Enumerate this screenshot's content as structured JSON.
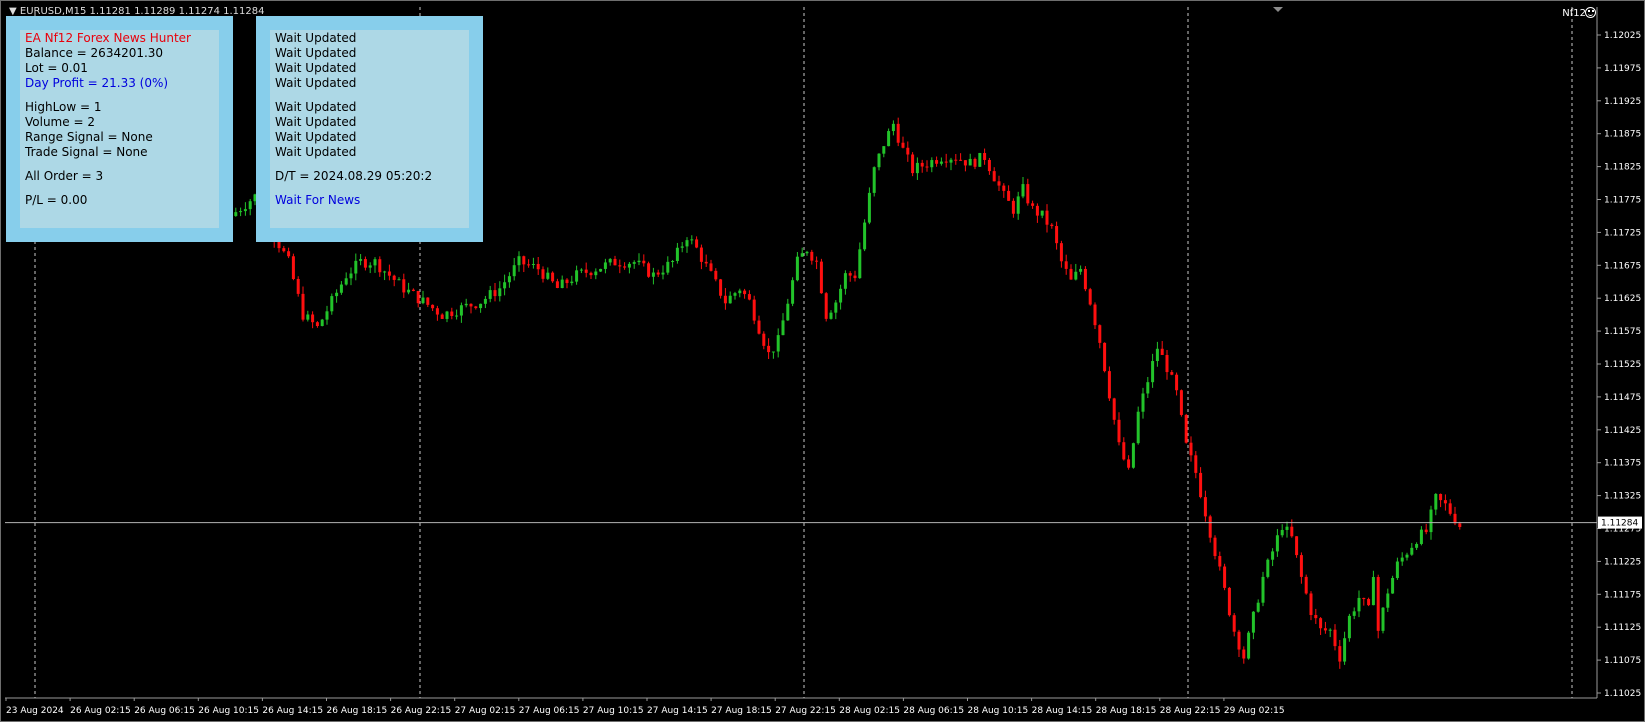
{
  "chart": {
    "symbol_line": "▼ EURUSD,M15  1.11281 1.11289 1.11274 1.11284",
    "ea_short_name": "Nf12",
    "current_price": "1.11284",
    "price_min": 1.1101,
    "price_max": 1.1205,
    "price_ticks": [
      "1.12025",
      "1.11975",
      "1.11925",
      "1.11875",
      "1.11825",
      "1.11775",
      "1.11725",
      "1.11675",
      "1.11625",
      "1.11575",
      "1.11525",
      "1.11475",
      "1.11425",
      "1.11375",
      "1.11325",
      "1.11275",
      "1.11225",
      "1.11175",
      "1.11125",
      "1.11075",
      "1.11025"
    ],
    "time_labels": [
      "23 Aug 2024",
      "26 Aug 02:15",
      "26 Aug 06:15",
      "26 Aug 10:15",
      "26 Aug 14:15",
      "26 Aug 18:15",
      "26 Aug 22:15",
      "27 Aug 02:15",
      "27 Aug 06:15",
      "27 Aug 10:15",
      "27 Aug 14:15",
      "27 Aug 18:15",
      "27 Aug 22:15",
      "28 Aug 02:15",
      "28 Aug 06:15",
      "28 Aug 10:15",
      "28 Aug 14:15",
      "28 Aug 18:15",
      "28 Aug 22:15",
      "29 Aug 02:15"
    ],
    "colors": {
      "bull": "#22c32a",
      "bear": "#ff0f0f",
      "grid": "#c8c8c8",
      "axis_text": "#ffffff",
      "background": "#000000"
    },
    "close_path": [
      [
        0,
        1.1175
      ],
      [
        5,
        1.1178
      ],
      [
        9,
        1.1172
      ],
      [
        12,
        1.1168
      ],
      [
        15,
        1.116
      ],
      [
        18,
        1.1158
      ],
      [
        21,
        1.1162
      ],
      [
        24,
        1.1166
      ],
      [
        27,
        1.1168
      ],
      [
        30,
        1.1168
      ],
      [
        33,
        1.1166
      ],
      [
        36,
        1.1164
      ],
      [
        40,
        1.1162
      ],
      [
        44,
        1.116
      ],
      [
        48,
        1.1161
      ],
      [
        52,
        1.1162
      ],
      [
        56,
        1.1164
      ],
      [
        60,
        1.1168
      ],
      [
        64,
        1.1167
      ],
      [
        68,
        1.1164
      ],
      [
        72,
        1.1166
      ],
      [
        76,
        1.1167
      ],
      [
        80,
        1.1168
      ],
      [
        84,
        1.1168
      ],
      [
        88,
        1.1166
      ],
      [
        92,
        1.1168
      ],
      [
        95,
        1.1172
      ],
      [
        97,
        1.117
      ],
      [
        100,
        1.1166
      ],
      [
        103,
        1.1162
      ],
      [
        106,
        1.1164
      ],
      [
        108,
        1.1162
      ],
      [
        110,
        1.1158
      ],
      [
        112,
        1.1154
      ],
      [
        114,
        1.1156
      ],
      [
        116,
        1.1162
      ],
      [
        118,
        1.1168
      ],
      [
        120,
        1.117
      ],
      [
        122,
        1.1168
      ],
      [
        124,
        1.116
      ],
      [
        126,
        1.1162
      ],
      [
        128,
        1.1166
      ],
      [
        130,
        1.1166
      ],
      [
        132,
        1.1174
      ],
      [
        134,
        1.1182
      ],
      [
        136,
        1.1186
      ],
      [
        138,
        1.1189
      ],
      [
        140,
        1.1185
      ],
      [
        142,
        1.1182
      ],
      [
        145,
        1.1183
      ],
      [
        148,
        1.1184
      ],
      [
        151,
        1.1184
      ],
      [
        154,
        1.1183
      ],
      [
        157,
        1.1184
      ],
      [
        159,
        1.1181
      ],
      [
        161,
        1.1178
      ],
      [
        163,
        1.1176
      ],
      [
        165,
        1.1179
      ],
      [
        167,
        1.1176
      ],
      [
        169,
        1.1175
      ],
      [
        171,
        1.1173
      ],
      [
        173,
        1.1168
      ],
      [
        175,
        1.1165
      ],
      [
        177,
        1.1167
      ],
      [
        179,
        1.1162
      ],
      [
        181,
        1.1156
      ],
      [
        183,
        1.1148
      ],
      [
        185,
        1.114
      ],
      [
        187,
        1.1136
      ],
      [
        189,
        1.1145
      ],
      [
        191,
        1.115
      ],
      [
        193,
        1.1155
      ],
      [
        195,
        1.1152
      ],
      [
        197,
        1.1148
      ],
      [
        199,
        1.114
      ],
      [
        201,
        1.1136
      ],
      [
        203,
        1.113
      ],
      [
        205,
        1.1124
      ],
      [
        207,
        1.1118
      ],
      [
        209,
        1.1112
      ],
      [
        211,
        1.1108
      ],
      [
        213,
        1.1114
      ],
      [
        215,
        1.112
      ],
      [
        217,
        1.1124
      ],
      [
        219,
        1.1128
      ],
      [
        221,
        1.1126
      ],
      [
        223,
        1.112
      ],
      [
        225,
        1.1115
      ],
      [
        227,
        1.1112
      ],
      [
        229,
        1.1112
      ],
      [
        231,
        1.1108
      ],
      [
        233,
        1.1114
      ],
      [
        235,
        1.1117
      ],
      [
        237,
        1.1115
      ],
      [
        238,
        1.1121
      ],
      [
        239,
        1.1112
      ],
      [
        241,
        1.1118
      ],
      [
        243,
        1.1122
      ],
      [
        245,
        1.1124
      ],
      [
        247,
        1.1126
      ],
      [
        249,
        1.1127
      ],
      [
        251,
        1.1132
      ],
      [
        253,
        1.1131
      ],
      [
        255,
        1.1129
      ],
      [
        256,
        1.1128
      ]
    ]
  },
  "left_panel": {
    "title": "EA Nf12 Forex News Hunter",
    "balance": "Balance = 2634201.30",
    "lot": "Lot = 0.01",
    "day_profit": "Day Profit = 21.33 (0%)",
    "highlow": "HighLow = 1",
    "volume": "Volume = 2",
    "range_signal": "Range Signal = None",
    "trade_signal": "Trade Signal = None",
    "all_order": "All Order = 3",
    "pl": "P/L = 0.00"
  },
  "right_panel": {
    "wait_lines": [
      "Wait Updated",
      "Wait Updated",
      "Wait Updated",
      "Wait Updated",
      "Wait Updated",
      "Wait Updated",
      "Wait Updated",
      "Wait Updated"
    ],
    "datetime": "D/T = 2024.08.29 05:20:2",
    "status": "Wait For News"
  }
}
